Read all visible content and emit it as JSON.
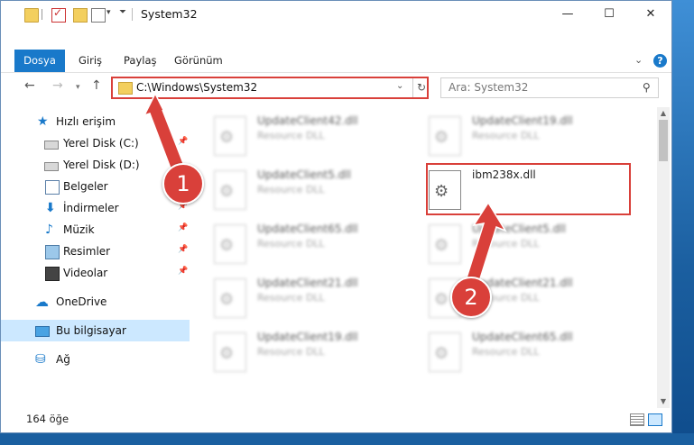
{
  "window": {
    "title": "System32",
    "minimize_glyph": "—",
    "maximize_glyph": "☐",
    "close_glyph": "✕"
  },
  "ribbon": {
    "tabs": [
      "Dosya",
      "Giriş",
      "Paylaş",
      "Görünüm"
    ],
    "help_label": "?"
  },
  "nav": {
    "address": "C:\\Windows\\System32",
    "search_placeholder": "Ara: System32"
  },
  "sidebar": {
    "items": [
      {
        "label": "Hızlı erişim",
        "icon": "star-icon"
      },
      {
        "label": "Yerel Disk (C:)",
        "icon": "drive-icon",
        "pinned": true
      },
      {
        "label": "Yerel Disk (D:)",
        "icon": "drive-icon"
      },
      {
        "label": "Belgeler",
        "icon": "documents-icon"
      },
      {
        "label": "İndirmeler",
        "icon": "downloads-icon",
        "pinned": true
      },
      {
        "label": "Müzik",
        "icon": "music-icon",
        "pinned": true
      },
      {
        "label": "Resimler",
        "icon": "pictures-icon",
        "pinned": true
      },
      {
        "label": "Videolar",
        "icon": "videos-icon",
        "pinned": true
      },
      {
        "label": "OneDrive",
        "icon": "onedrive-icon"
      },
      {
        "label": "Bu bilgisayar",
        "icon": "this-pc-icon",
        "selected": true
      },
      {
        "label": "Ağ",
        "icon": "network-icon"
      }
    ]
  },
  "files": [
    {
      "name": "UpdateClient42.dll",
      "type": "Resource DLL"
    },
    {
      "name": "UpdateClient19.dll",
      "type": "Resource DLL"
    },
    {
      "name": "UpdateClient5.dll",
      "type": "Resource DLL"
    },
    {
      "name": "ibm238x.dll",
      "type": ""
    },
    {
      "name": "UpdateClient65.dll",
      "type": "Resource DLL"
    },
    {
      "name": "UpdateClient5.dll",
      "type": "Resource DLL"
    },
    {
      "name": "UpdateClient21.dll",
      "type": "Resource DLL"
    },
    {
      "name": "UpdateClient21.dll",
      "type": "Resource DLL"
    },
    {
      "name": "UpdateClient19.dll",
      "type": "Resource DLL"
    },
    {
      "name": "UpdateClient65.dll",
      "type": "Resource DLL"
    }
  ],
  "status": {
    "item_count": "164 öğe"
  },
  "annotations": {
    "step1": "1",
    "step2": "2",
    "color": "#d9403a"
  }
}
